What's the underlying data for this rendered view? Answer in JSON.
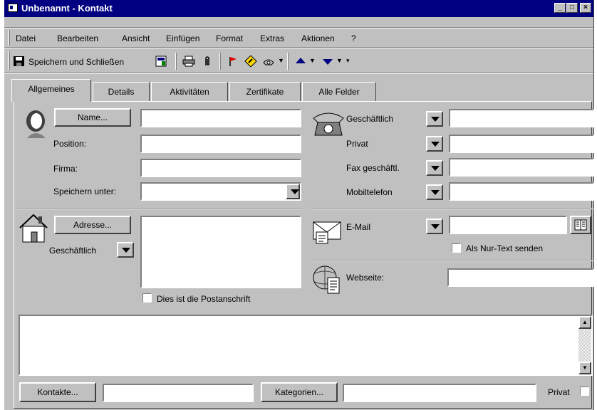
{
  "window": {
    "title": "Unbenannt - Kontakt"
  },
  "menu": [
    "Datei",
    "Bearbeiten",
    "Ansicht",
    "Einfügen",
    "Format",
    "Extras",
    "Aktionen",
    "?"
  ],
  "toolbar": {
    "save_close": "Speichern und Schließen"
  },
  "tabs": [
    "Allgemeines",
    "Details",
    "Aktivitäten",
    "Zertifikate",
    "Alle Felder"
  ],
  "left": {
    "name_button": "Name...",
    "position_label": "Position:",
    "company_label": "Firma:",
    "save_as_label": "Speichern unter:",
    "address_button": "Adresse...",
    "address_type": "Geschäftlich",
    "postal_checkbox": "Dies ist die Postanschrift"
  },
  "right": {
    "phone_types": [
      "Geschäftlich",
      "Privat",
      "Fax geschäftl.",
      "Mobiltelefon"
    ],
    "email_label": "E-Mail",
    "plain_text_checkbox": "Als Nur-Text senden",
    "website_label": "Webseite:"
  },
  "bottom": {
    "contacts_button": "Kontakte...",
    "categories_button": "Kategorien...",
    "private_label": "Privat"
  }
}
